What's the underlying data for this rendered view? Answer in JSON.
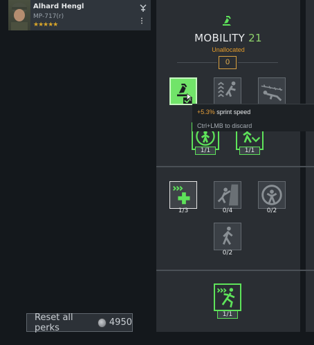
{
  "soldier": {
    "name": "Alhard Hengl",
    "weapon": "MP-717(r)",
    "stars": "★★★★★"
  },
  "reset": {
    "label": "Reset all perks",
    "cost": "4950"
  },
  "mobility": {
    "title": "MOBILITY",
    "level": "21",
    "status": "Unallocated",
    "unallocated_points": "0"
  },
  "perks": {
    "row2": [
      {
        "count": "1/1"
      },
      {
        "count": "1/1"
      }
    ],
    "mid": [
      {
        "count": "1/3"
      },
      {
        "count": "0/4"
      },
      {
        "count": "0/2"
      },
      {
        "count": "0/2"
      }
    ],
    "bottom": [
      {
        "count": "1/1"
      }
    ]
  },
  "tooltip": {
    "value": "+5.3%",
    "text": " sprint speed",
    "hint": "Ctrl+LMB to discard"
  },
  "colors": {
    "accent": "#5ee35a",
    "warning": "#e29a2a",
    "panel": "#2a2e33"
  }
}
